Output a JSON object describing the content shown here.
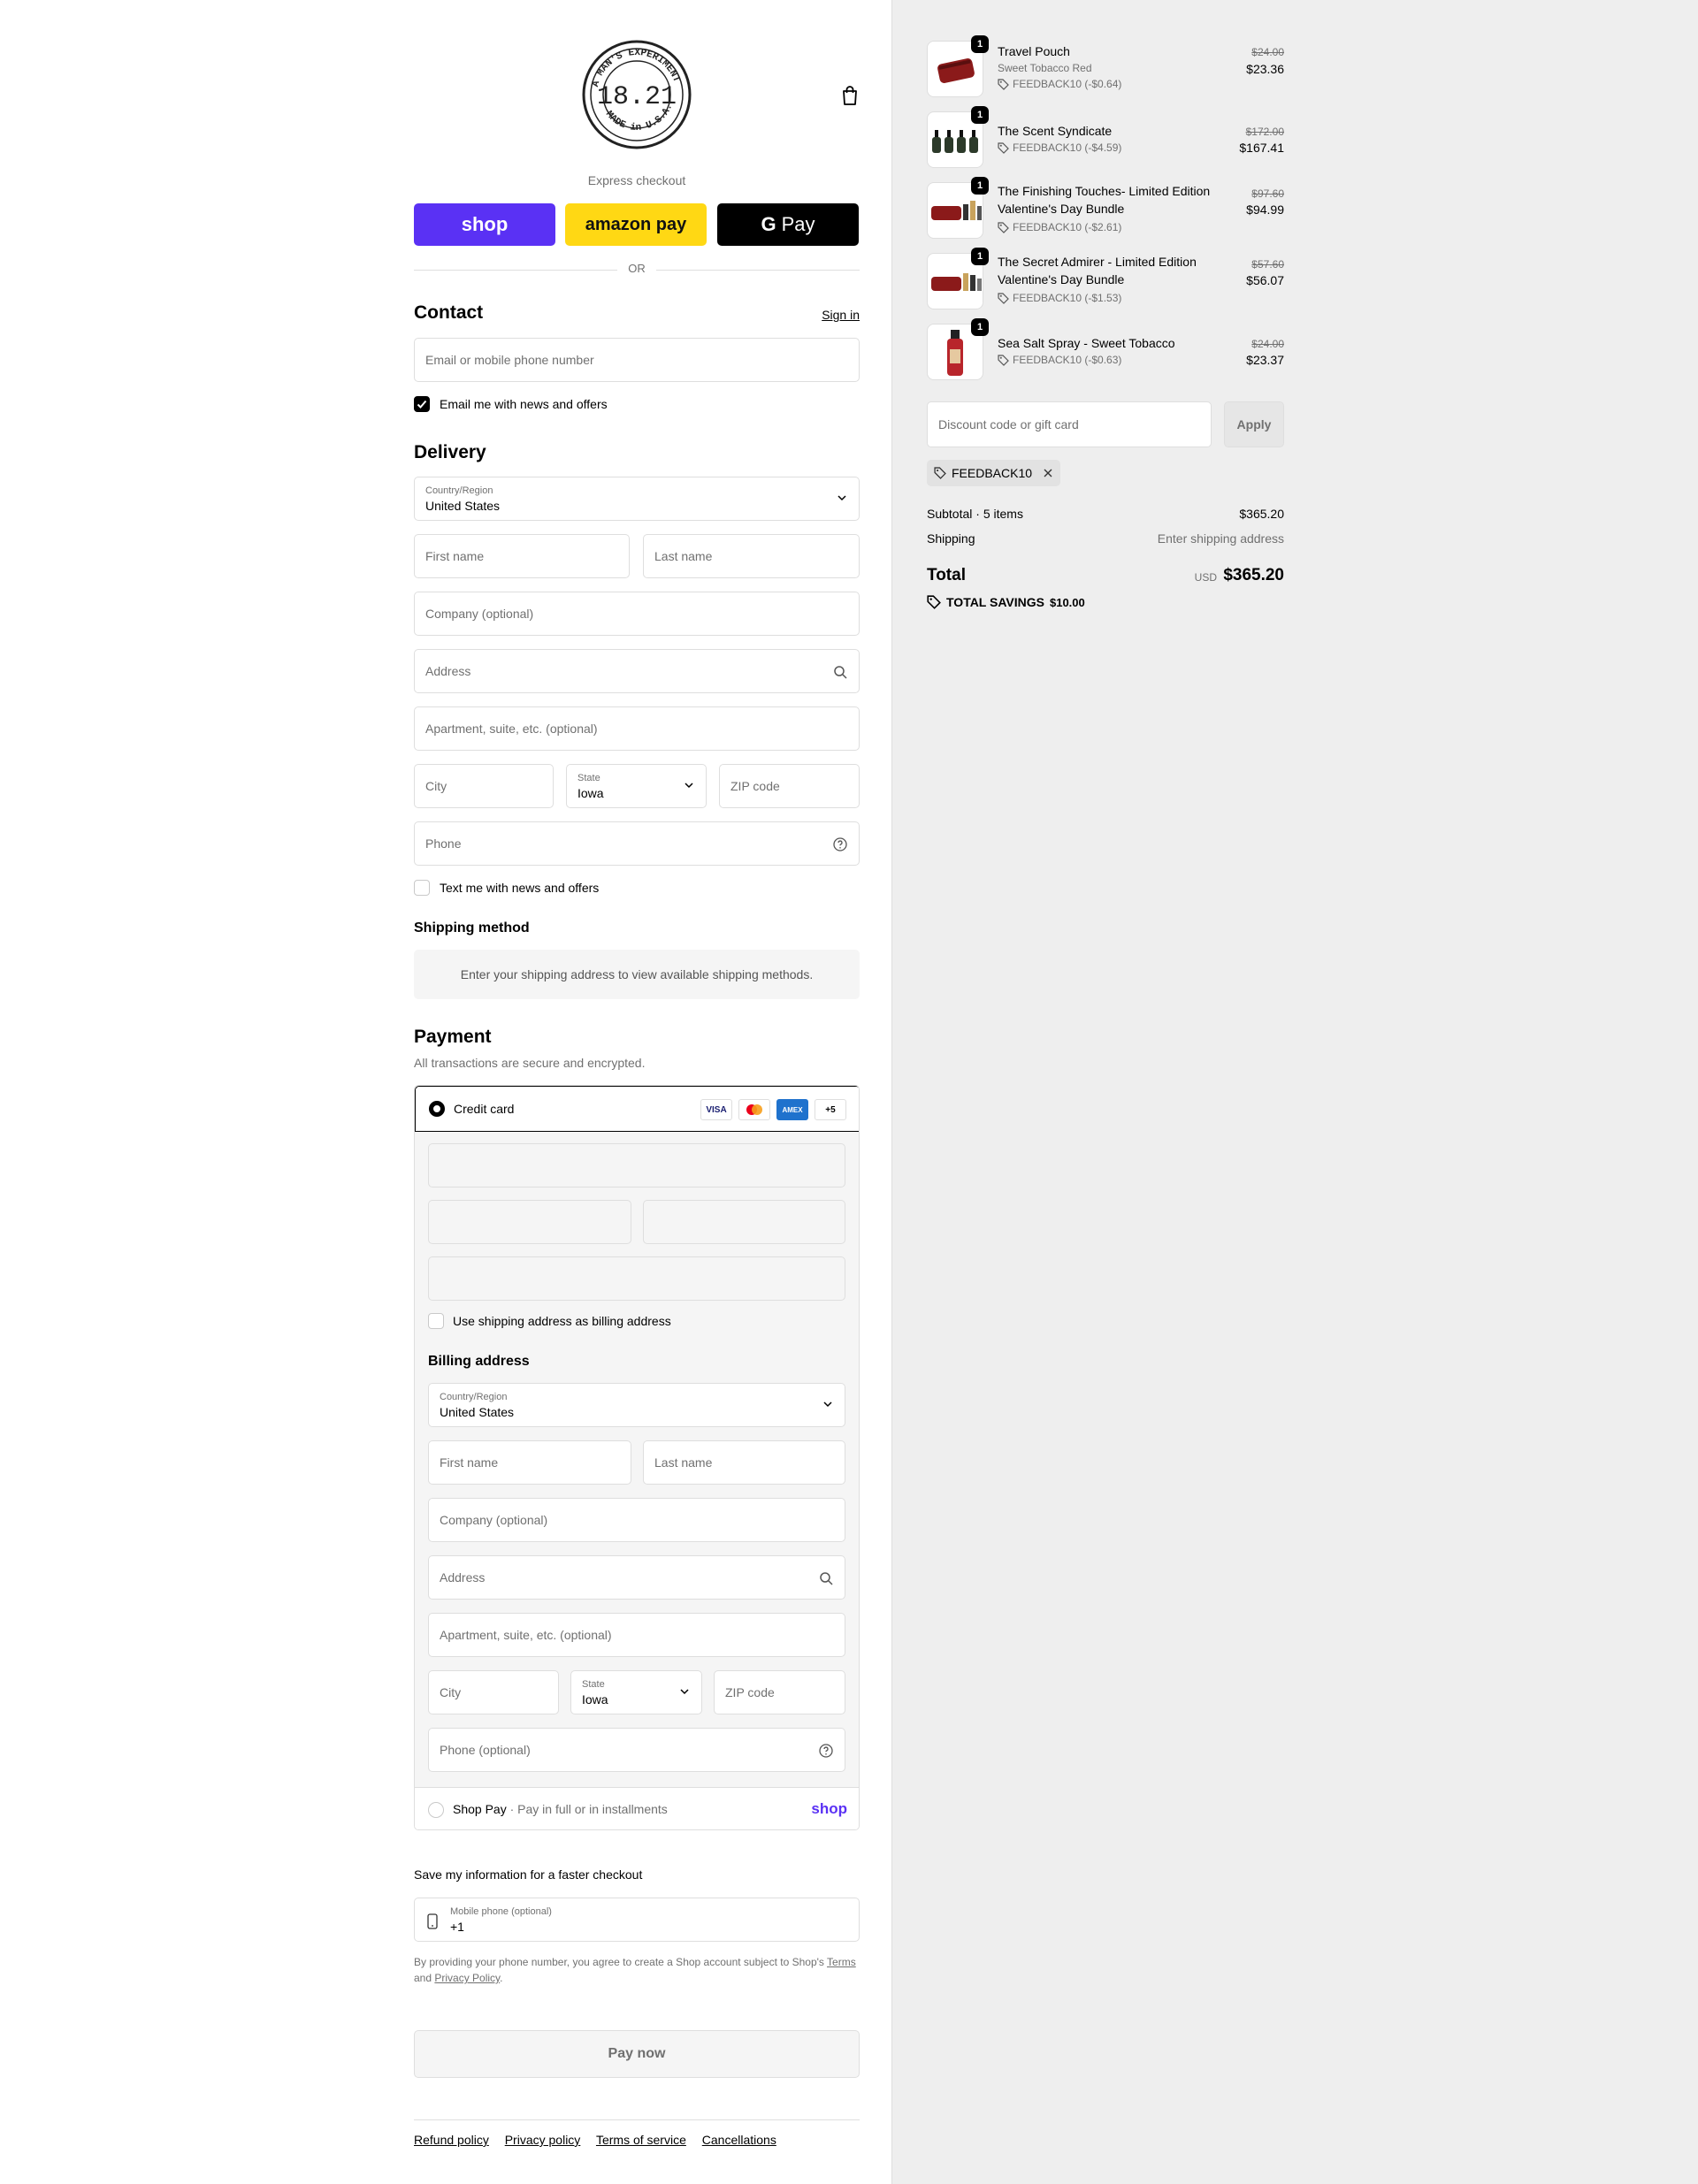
{
  "header": {
    "logo_alt": "1821 Man Made Experiment - Made in U.S.A.",
    "logo_text": "18.21"
  },
  "express": {
    "title": "Express checkout",
    "shop_label": "shop",
    "amazon_label": "amazon pay",
    "gpay_label": "Pay",
    "or_label": "OR"
  },
  "contact": {
    "title": "Contact",
    "sign_in": "Sign in",
    "email_placeholder": "Email or mobile phone number",
    "news_label": "Email me with news and offers",
    "news_checked": true
  },
  "delivery": {
    "title": "Delivery",
    "country_label": "Country/Region",
    "country_value": "United States",
    "first_name": "First name",
    "last_name": "Last name",
    "company": "Company (optional)",
    "address": "Address",
    "apartment": "Apartment, suite, etc. (optional)",
    "city": "City",
    "state_label": "State",
    "state_value": "Iowa",
    "zip": "ZIP code",
    "phone": "Phone",
    "text_label": "Text me with news and offers"
  },
  "shipping": {
    "title": "Shipping method",
    "message": "Enter your shipping address to view available shipping methods."
  },
  "payment": {
    "title": "Payment",
    "subtitle": "All transactions are secure and encrypted.",
    "credit_card": "Credit card",
    "cards": [
      "VISA",
      "MC",
      "AMEX",
      "+5"
    ],
    "billing_same": "Use shipping address as billing address",
    "shop_pay": "Shop Pay",
    "shop_pay_sub": "Pay in full or in installments",
    "shop_pay_logo": "shop"
  },
  "billing": {
    "title": "Billing address",
    "country_label": "Country/Region",
    "country_value": "United States",
    "first_name": "First name",
    "last_name": "Last name",
    "company": "Company (optional)",
    "address": "Address",
    "apartment": "Apartment, suite, etc. (optional)",
    "city": "City",
    "state_label": "State",
    "state_value": "Iowa",
    "zip": "ZIP code",
    "phone": "Phone (optional)"
  },
  "save_info": {
    "title": "Save my information for a faster checkout",
    "mobile_label": "Mobile phone (optional)",
    "mobile_value": "+1",
    "terms_prefix": "By providing your phone number, you agree to create a Shop account subject to Shop's",
    "terms_link": "Terms",
    "and": "and",
    "privacy_link": "Privacy Policy"
  },
  "pay_now": "Pay now",
  "footer": [
    "Refund policy",
    "Privacy policy",
    "Terms of service",
    "Cancellations"
  ],
  "cart": {
    "items": [
      {
        "name": "Travel Pouch",
        "variant": "Sweet Tobacco Red",
        "discount": "FEEDBACK10 (-$0.64)",
        "orig": "$24.00",
        "price": "$23.36",
        "qty": "1"
      },
      {
        "name": "The Scent Syndicate",
        "variant": "",
        "discount": "FEEDBACK10 (-$4.59)",
        "orig": "$172.00",
        "price": "$167.41",
        "qty": "1"
      },
      {
        "name": "The Finishing Touches- Limited Edition Valentine's Day Bundle",
        "variant": "",
        "discount": "FEEDBACK10 (-$2.61)",
        "orig": "$97.60",
        "price": "$94.99",
        "qty": "1"
      },
      {
        "name": "The Secret Admirer - Limited Edition Valentine's Day Bundle",
        "variant": "",
        "discount": "FEEDBACK10 (-$1.53)",
        "orig": "$57.60",
        "price": "$56.07",
        "qty": "1"
      },
      {
        "name": "Sea Salt Spray - Sweet Tobacco",
        "variant": "",
        "discount": "FEEDBACK10 (-$0.63)",
        "orig": "$24.00",
        "price": "$23.37",
        "qty": "1"
      }
    ],
    "discount_placeholder": "Discount code or gift card",
    "apply": "Apply",
    "applied_code": "FEEDBACK10",
    "subtotal_label": "Subtotal · 5 items",
    "subtotal_value": "$365.20",
    "shipping_label": "Shipping",
    "shipping_value": "Enter shipping address",
    "total_label": "Total",
    "currency": "USD",
    "total_value": "$365.20",
    "savings_label": "TOTAL SAVINGS",
    "savings_value": "$10.00"
  },
  "colors": {
    "shop_purple": "#5a31f4",
    "amazon_yellow": "#ffd814",
    "panel_grey": "#eeeeee"
  }
}
